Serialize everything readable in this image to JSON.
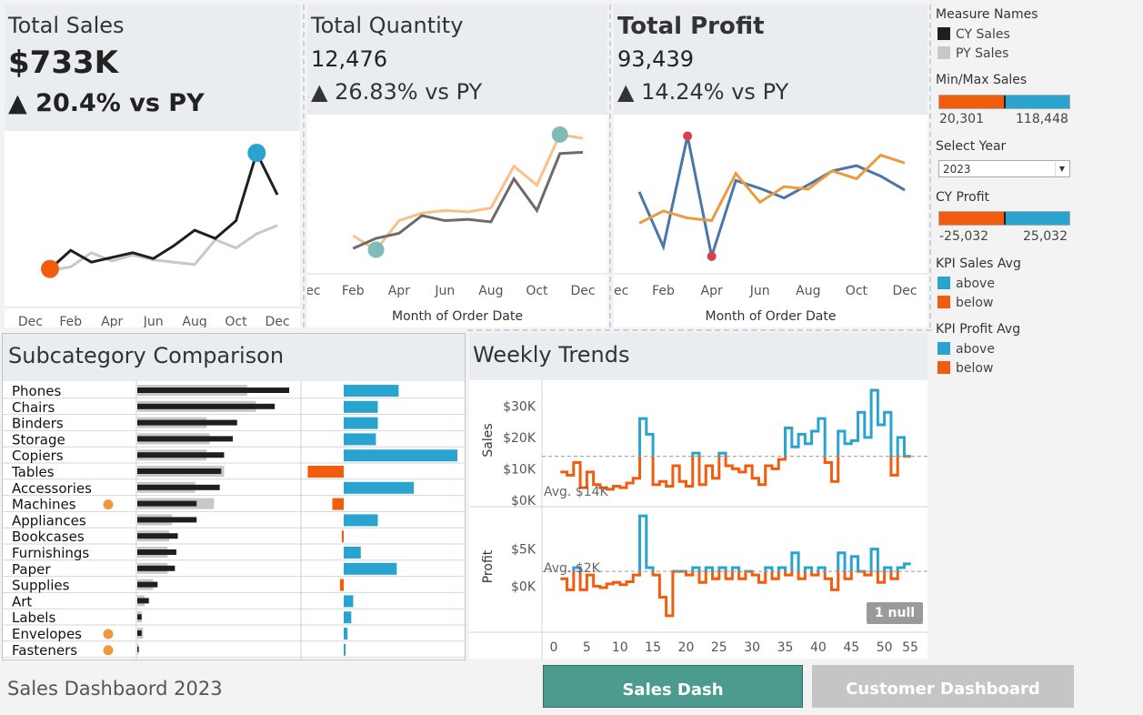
{
  "kpis": {
    "sales": {
      "title": "Total Sales",
      "value": "$733K",
      "delta": "▲ 20.4% vs PY"
    },
    "quantity": {
      "title": "Total Quantity",
      "value": "12,476",
      "delta": "▲ 26.83% vs PY"
    },
    "profit": {
      "title": "Total Profit",
      "value": "93,439",
      "delta": "▲ 14.24% vs PY"
    }
  },
  "month_ticks": [
    "Dec",
    "Feb",
    "Apr",
    "Jun",
    "Aug",
    "Oct",
    "Dec"
  ],
  "month_axis_title": "Month of Order Date",
  "sales_lines": {
    "cy": [
      20301,
      36000,
      26000,
      30000,
      34000,
      29000,
      40000,
      53000,
      46000,
      61000,
      118448,
      83000
    ],
    "py": [
      19000,
      22000,
      34000,
      27000,
      32000,
      28000,
      26000,
      24000,
      45000,
      38000,
      50000,
      57000
    ]
  },
  "quantity_lines": {
    "cy": [
      600,
      680,
      720,
      860,
      820,
      830,
      810,
      1150,
      900,
      1350,
      1360
    ],
    "py": [
      700,
      590,
      820,
      880,
      900,
      890,
      920,
      1250,
      1100,
      1500,
      1470
    ]
  },
  "profit_lines": {
    "cy": [
      -1200,
      200,
      -600,
      -900,
      4500,
      1200,
      3000,
      2700,
      4800,
      3900,
      6600,
      5700
    ],
    "py": [
      2400,
      -3900,
      8800,
      -5000,
      3700,
      2800,
      1700,
      3200,
      4800,
      5400,
      4200,
      2600
    ]
  },
  "subcategory": {
    "title": "Subcategory Comparison",
    "rows": [
      {
        "name": "Phones",
        "cy": 105000,
        "py": 76000,
        "diff": 29000,
        "flag": false
      },
      {
        "name": "Chairs",
        "cy": 95000,
        "py": 82000,
        "diff": 18000,
        "flag": false
      },
      {
        "name": "Binders",
        "cy": 69000,
        "py": 48000,
        "diff": 18000,
        "flag": false
      },
      {
        "name": "Storage",
        "cy": 66000,
        "py": 50000,
        "diff": 17000,
        "flag": false
      },
      {
        "name": "Copiers",
        "cy": 60000,
        "py": 48000,
        "diff": 60000,
        "flag": false
      },
      {
        "name": "Tables",
        "cy": 58000,
        "py": 60000,
        "diff": -19000,
        "flag": false
      },
      {
        "name": "Accessories",
        "cy": 57000,
        "py": 40000,
        "diff": 37000,
        "flag": false
      },
      {
        "name": "Machines",
        "cy": 41000,
        "py": 53000,
        "diff": -6000,
        "flag": true
      },
      {
        "name": "Appliances",
        "cy": 41000,
        "py": 24000,
        "diff": 18000,
        "flag": false
      },
      {
        "name": "Bookcases",
        "cy": 28000,
        "py": 22000,
        "diff": -1000,
        "flag": false
      },
      {
        "name": "Furnishings",
        "cy": 27000,
        "py": 21000,
        "diff": 9000,
        "flag": false
      },
      {
        "name": "Paper",
        "cy": 26000,
        "py": 21000,
        "diff": 28000,
        "flag": false
      },
      {
        "name": "Supplies",
        "cy": 14000,
        "py": 11000,
        "diff": -2000,
        "flag": false
      },
      {
        "name": "Art",
        "cy": 8000,
        "py": 5000,
        "diff": 5000,
        "flag": false
      },
      {
        "name": "Labels",
        "cy": 3000,
        "py": 3000,
        "diff": 4000,
        "flag": false
      },
      {
        "name": "Envelopes",
        "cy": 3000,
        "py": 4000,
        "diff": 2000,
        "flag": true
      },
      {
        "name": "Fasteners",
        "cy": 1000,
        "py": 1000,
        "diff": 1000,
        "flag": true
      }
    ]
  },
  "weekly": {
    "title": "Weekly Trends",
    "sales_label": "Sales",
    "profit_label": "Profit",
    "sales_ticks": [
      "$30K",
      "$20K",
      "$10K",
      "$0K"
    ],
    "profit_ticks": [
      "$5K",
      "$0K"
    ],
    "sales_avg_label": "Avg. $14K",
    "profit_avg_label": "Avg. $2K",
    "null_badge": "1 null",
    "x_ticks": [
      "0",
      "5",
      "10",
      "15",
      "20",
      "25",
      "30",
      "35",
      "40",
      "45",
      "50",
      "55"
    ],
    "sales_avg": 14000,
    "profit_avg": 2000,
    "sales_values": [
      9000,
      8000,
      12000,
      4000,
      9000,
      5000,
      4000,
      3500,
      4500,
      4000,
      5500,
      7000,
      26000,
      21000,
      5000,
      6000,
      4500,
      11000,
      6000,
      4500,
      15000,
      5000,
      11000,
      7000,
      15000,
      11000,
      10000,
      9000,
      11000,
      7000,
      5000,
      11000,
      10000,
      13000,
      23000,
      17000,
      21000,
      18000,
      22000,
      26000,
      12000,
      6000,
      22000,
      18000,
      19000,
      28000,
      20000,
      35000,
      24000,
      28000,
      8000,
      20000,
      14000
    ],
    "profit_values": [
      1000,
      -500,
      2500,
      -500,
      1500,
      0,
      -200,
      300,
      500,
      200,
      600,
      1500,
      9500,
      2500,
      1500,
      -1500,
      -4000,
      2000,
      2000,
      1500,
      2500,
      500,
      2500,
      1000,
      2500,
      1000,
      2500,
      1000,
      2000,
      1500,
      500,
      2500,
      1000,
      2500,
      1500,
      4500,
      1000,
      2500,
      1500,
      2500,
      1000,
      -500,
      4500,
      1000,
      4000,
      2000,
      1500,
      5000,
      500,
      2500,
      1000,
      2500,
      3000
    ]
  },
  "legend": {
    "measure_names_title": "Measure Names",
    "cy_label": "CY Sales",
    "py_label": "PY Sales",
    "minmax_title": "Min/Max Sales",
    "minmax_min": "20,301",
    "minmax_max": "118,448",
    "select_year_title": "Select Year",
    "select_year_value": "2023",
    "cy_profit_title": "CY Profit",
    "cy_profit_min": "-25,032",
    "cy_profit_max": "25,032",
    "kpi_sales_avg_title": "KPI Sales Avg",
    "kpi_profit_avg_title": "KPI Profit Avg",
    "above_label": "above",
    "below_label": "below"
  },
  "footer": {
    "title": "Sales Dashbaord 2023",
    "sales_dash_button": "Sales Dash",
    "customer_dash_button": "Customer Dashboard"
  },
  "colors": {
    "cy": "#1f1f1f",
    "py": "#c8c8c8",
    "blue": "#2ba3cf",
    "orange": "#f25c0f",
    "qty_cy": "#f8c18a",
    "qty_py": "#6f6a68",
    "profit_cy": "#4a77a8",
    "profit_py": "#ed9a3f",
    "teal": "#7fbcb5",
    "btn_active": "#4c9b8f",
    "btn_inactive": "#c5c5c5"
  }
}
